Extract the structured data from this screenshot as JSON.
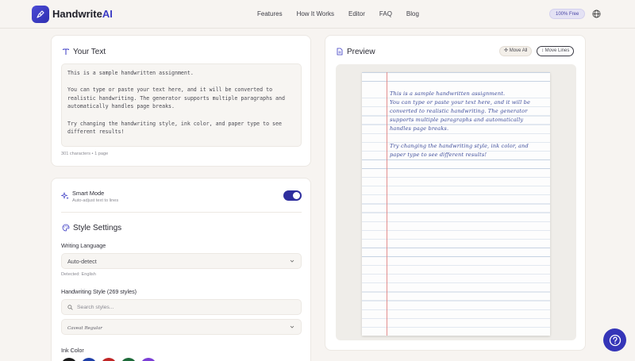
{
  "header": {
    "brand_name": "Handwrite",
    "brand_suffix": "AI",
    "nav": [
      "Features",
      "How It Works",
      "Editor",
      "FAQ",
      "Blog"
    ],
    "plan_badge": "100% Free",
    "icons": {
      "logo": "pen-nib-icon",
      "language": "globe-icon"
    }
  },
  "text_card": {
    "title": "Your Text",
    "icon": "text-type-icon",
    "content": "This is a sample handwritten assignment.\n\nYou can type or paste your text here, and it will be converted to\nrealistic handwriting. The generator supports multiple paragraphs and\nautomatically handles page breaks.\n\nTry changing the handwriting style, ink color, and paper type to see\ndifferent results!",
    "count": "301 characters • 1 page"
  },
  "style_card": {
    "smart_mode": {
      "label": "Smart Mode",
      "sublabel": "Auto-adjust text to lines",
      "enabled": true,
      "icon": "sparkles-icon"
    },
    "title": "Style Settings",
    "icon": "palette-icon",
    "writing_language": {
      "label": "Writing Language",
      "value": "Auto-detect",
      "detected": "Detected: English"
    },
    "handwriting_style": {
      "label": "Handwriting Style (269 styles)",
      "search_placeholder": "Search styles...",
      "value": "Caveat Regular"
    },
    "ink_color": {
      "label": "Ink Color",
      "colors": [
        "#1a1a1a",
        "#1f3fa8",
        "#c02626",
        "#1e6b3a",
        "#7b3fd6"
      ]
    }
  },
  "preview_card": {
    "title": "Preview",
    "icon": "document-icon",
    "move_all": "Move All",
    "move_lines": "Move Lines",
    "handwritten_lines": [
      "This is a sample handwritten assignment.",
      "You can type or paste your text here, and it will be",
      "converted to realistic handwriting. The generator",
      "supports multiple paragraphs and automatically",
      "handles page breaks.",
      "",
      "Try changing the handwriting style, ink color, and",
      "paper type to see different results!"
    ]
  },
  "help_button": {
    "icon": "question-icon"
  }
}
